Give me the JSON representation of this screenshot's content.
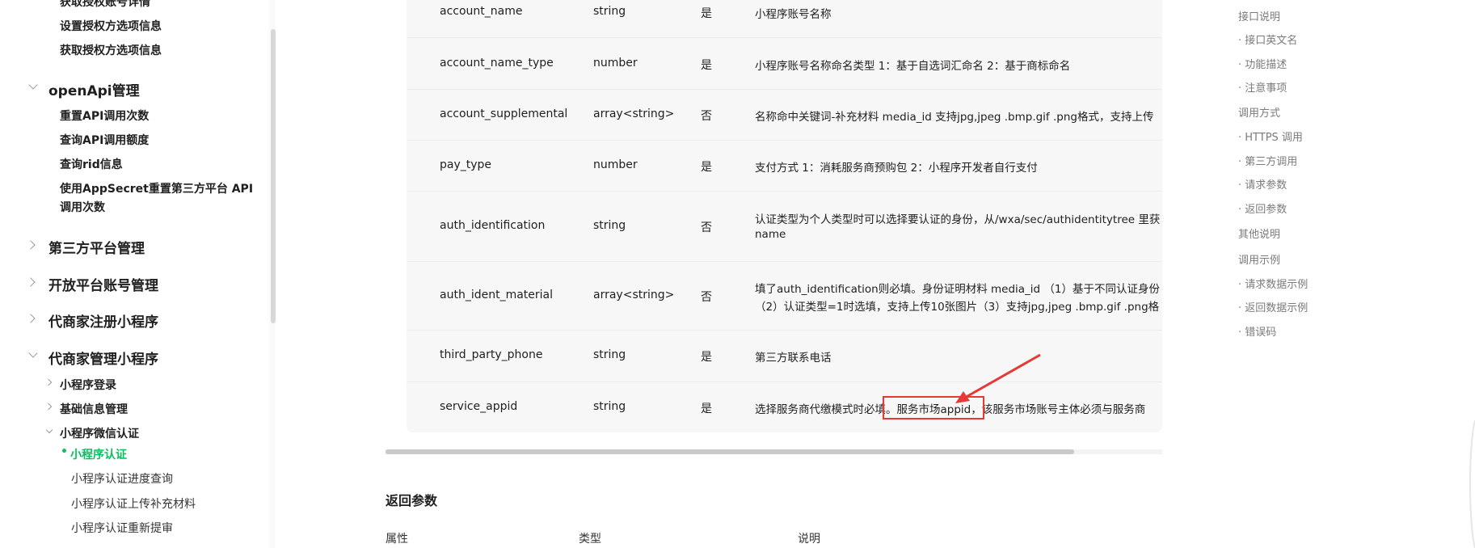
{
  "sidebar": {
    "top_items": [
      "获取授权账号详情",
      "设置授权方选项信息",
      "获取授权方选项信息"
    ],
    "openapi": {
      "label": "openApi管理",
      "items": [
        "重置API调用次数",
        "查询API调用额度",
        "查询rid信息",
        "使用AppSecret重置第三方平台 API",
        "调用次数"
      ]
    },
    "groups": [
      "第三方平台管理",
      "开放平台账号管理",
      "代商家注册小程序",
      "代商家管理小程序"
    ],
    "mgmt_children": [
      "小程序登录",
      "基础信息管理",
      "小程序微信认证"
    ],
    "auth_leaves": {
      "active": "小程序认证",
      "items": [
        "小程序认证进度查询",
        "小程序认证上传补充材料",
        "小程序认证重新提审"
      ]
    }
  },
  "params_table": {
    "rows": [
      {
        "name": "account_name",
        "type": "string",
        "required": "是",
        "desc": "小程序账号名称"
      },
      {
        "name": "account_name_type",
        "type": "number",
        "required": "是",
        "desc": "小程序账号名称命名类型 1：基于自选词汇命名 2：基于商标命名"
      },
      {
        "name": "account_supplemental",
        "type": "array<string>",
        "required": "否",
        "desc": "名称命中关键词-补充材料 media_id 支持jpg,jpeg .bmp.gif .png格式，支持上传"
      },
      {
        "name": "pay_type",
        "type": "number",
        "required": "是",
        "desc": "支付方式 1：消耗服务商预购包 2：小程序开发者自行支付"
      },
      {
        "name": "auth_identification",
        "type": "string",
        "required": "否",
        "desc": "认证类型为个人类型时可以选择要认证的身份，从/wxa/sec/authidentitytree 里获",
        "desc2": "name"
      },
      {
        "name": "auth_ident_material",
        "type": "array<string>",
        "required": "否",
        "desc": "填了auth_identification则必填。身份证明材料 media_id （1）基于不同认证身份",
        "desc2": "（2）认证类型=1时选填，支持上传10张图片（3）支持jpg,jpeg .bmp.gif .png格"
      },
      {
        "name": "third_party_phone",
        "type": "string",
        "required": "是",
        "desc": "第三方联系电话"
      },
      {
        "name": "service_appid",
        "type": "string",
        "required": "是",
        "desc": "选择服务商代缴模式时必填。服务市场appid，该服务市场账号主体必须与服务商"
      }
    ]
  },
  "return_section": {
    "title": "返回参数",
    "headers": [
      "属性",
      "类型",
      "说明"
    ]
  },
  "toc": {
    "items": [
      "接口说明",
      "· 接口英文名",
      "· 功能描述",
      "· 注意事项",
      "调用方式",
      "· HTTPS 调用",
      "· 第三方调用",
      "· 请求参数",
      "· 返回参数",
      "其他说明",
      "调用示例",
      "· 请求数据示例",
      "· 返回数据示例",
      "· 错误码"
    ]
  },
  "colors": {
    "accent": "#07c160",
    "annotation": "#e53935",
    "table_bg": "#f7f7f7"
  }
}
